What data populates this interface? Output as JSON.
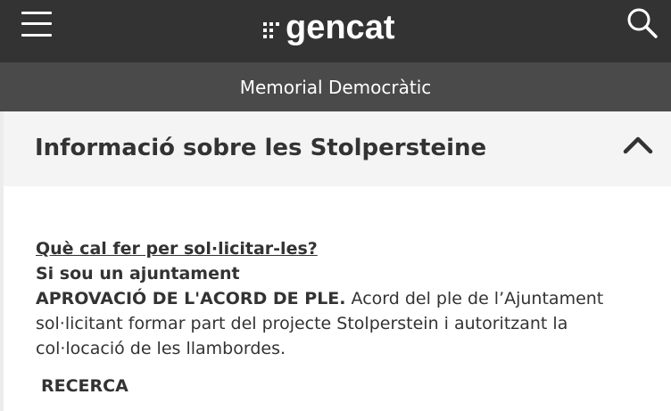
{
  "header": {
    "logo_text": "gencat",
    "menu_icon": "hamburger-menu-icon",
    "search_icon": "search-icon",
    "background": "#333333"
  },
  "subheader": {
    "title": "Memorial Democràtic",
    "background": "#4a4a4a"
  },
  "accordion": {
    "title": "Informació sobre les Stolpersteine",
    "toggle_icon": "chevron-up-icon",
    "background": "#f4f4f4"
  },
  "content": {
    "question_link": "Què cal fer per sol·licitar-les?",
    "subheading": "Si sou un ajuntament",
    "lead": "APROVACIÓ DE L'ACORD DE PLE.",
    "paragraph": " Acord del ple de l’Ajuntament sol·licitant formar part del projecte Stolperstein i autoritzant la col·locació de les llambordes.",
    "section_label": "RECERCA"
  }
}
